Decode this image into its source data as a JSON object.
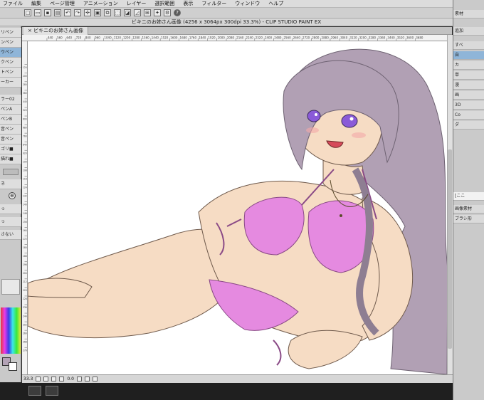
{
  "app": {
    "window_title": "ビキニのお姉さん画像 (4256 x 3064px 300dpi 33.3%)  - CLIP STUDIO PAINT EX",
    "canvas_tab": "ビキニのお姉さん画像"
  },
  "menu": [
    "ファイル",
    "編集",
    "ページ管理",
    "アニメーション",
    "レイヤー",
    "選択範囲",
    "表示",
    "フィルター",
    "ウィンドウ",
    "ヘルプ"
  ],
  "left_panel": {
    "items": [
      "リペン",
      "ンペン",
      "ウペン",
      "クペン",
      "トペン",
      "ーカー",
      "ラー02",
      "ペンA",
      "ペンB",
      "音ペン",
      "音ペン",
      "ゴリ■",
      "描れ■"
    ],
    "selected_index": 2,
    "lower_items": [
      "ネ",
      "っ",
      "っ",
      "さない"
    ]
  },
  "ruler_top": [
    "440",
    "560",
    "640",
    "720",
    "840",
    "960",
    "1040",
    "1120",
    "1200",
    "1280",
    "1360",
    "1440",
    "1520",
    "1600",
    "1680",
    "1760",
    "1840",
    "1920",
    "2000",
    "2080",
    "2160",
    "2240",
    "2320",
    "2400",
    "2480",
    "2560",
    "2640",
    "2720",
    "2800",
    "2880",
    "2960",
    "3040",
    "3120",
    "3200",
    "3280",
    "3360",
    "3440",
    "3520",
    "3600",
    "3680"
  ],
  "ruler_left": [
    "120",
    "200",
    "280",
    "360",
    "440",
    "520",
    "600",
    "680",
    "760",
    "840",
    "920",
    "1000",
    "1080",
    "1160",
    "1240",
    "1320",
    "1400",
    "1480",
    "1560",
    "1640",
    "1720",
    "1800",
    "1880",
    "1960",
    "2040",
    "2120",
    "2200",
    "2280",
    "2360",
    "2440",
    "2520",
    "2600",
    "2680",
    "2760"
  ],
  "status": {
    "zoom": "33.3",
    "rotation": "0.0"
  },
  "right_panel": {
    "header": "素材",
    "items": [
      "追加",
      "すべ",
      "自",
      "カ",
      "単",
      "漫",
      "画",
      "3D",
      "Co",
      "ダ"
    ],
    "search_placeholder": "[ここ",
    "tags": [
      "画像素材",
      "ブラシ形"
    ]
  },
  "colors": {
    "accent": "#8fb5d8",
    "hair": "#b1a0b4",
    "skin": "#f6dcc4",
    "bikini": "#e58ae0",
    "eye": "#8a5ad8"
  }
}
